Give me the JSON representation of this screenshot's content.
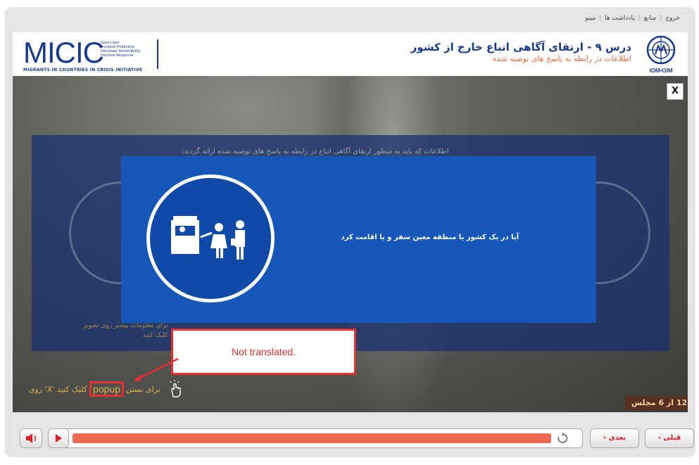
{
  "top_menu": [
    "خروج",
    "منابع",
    "یادداشت ها",
    "مینو"
  ],
  "micic": {
    "logo": "MICIC",
    "tagline": [
      "Save Lives",
      "Increase Protection",
      "Decrease Vulnerability",
      "Improve Response"
    ],
    "subtitle": "MIGRANTS IN COUNTRIES IN CRISIS INITIATIVE"
  },
  "lesson": {
    "title": "درس ۹ - ارتقای آگاهی اتباع خارج از کشور",
    "subtitle": "اطلاعات در رابطه به پاسخ های توصیه شده"
  },
  "iom_label": "IOM•OIM",
  "close_label": "X",
  "background_text": "اطلاعات که باید به منظور ارتقای آگاهی اتباع در رابطه به پاسخ های توصیه شده ارائه گردند:",
  "popup": {
    "text": "آیا در یک کشور یا منطقه معین سفر و یا اقامت کرد"
  },
  "old_hint": [
    "برای معلومات بیشتر روی تصویر",
    "کلیک کنید"
  ],
  "note": "Not translated.",
  "close_hint": {
    "before": "کلیک کنید 'X' روی",
    "word": "popup",
    "after": "برای بستن"
  },
  "slide_counter": "12 از 6 مجلس",
  "controls": {
    "next_label": "بعدی",
    "prev_label": "قبلی"
  },
  "colors": {
    "brand_blue": "#1a3a8c",
    "accent_orange": "#e36d3c",
    "popup_blue": "#1657b8",
    "progress": "#ec6b50",
    "note_red": "#e03030"
  },
  "progress": {
    "percent": 100
  }
}
